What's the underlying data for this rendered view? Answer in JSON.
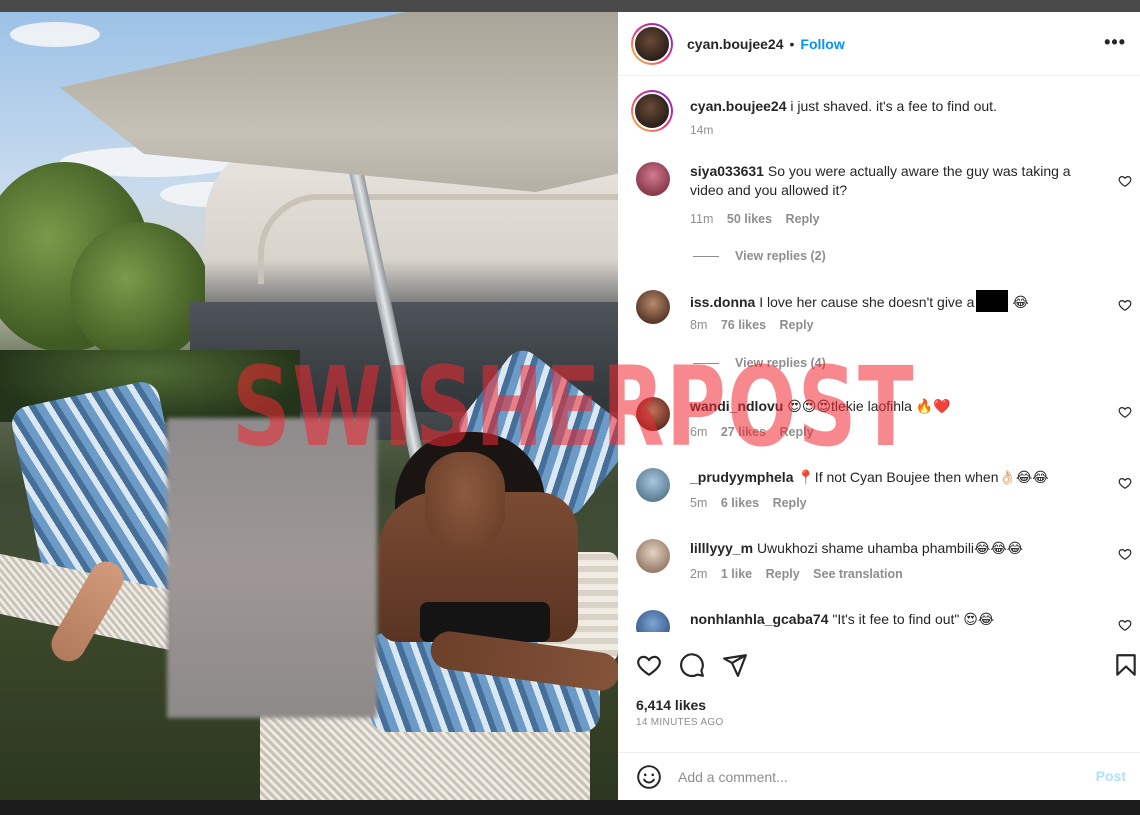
{
  "post": {
    "username": "cyan.boujee24",
    "follow_label": "Follow",
    "separator": "•",
    "more_label": "•••",
    "watermark": "SWISHERPOST"
  },
  "caption": {
    "username": "cyan.boujee24",
    "text": "i just shaved. it's a fee to find out.",
    "time": "14m"
  },
  "comments": [
    {
      "username": "siya033631",
      "text": "So you were actually aware the guy was taking a video and you allowed it?",
      "time": "11m",
      "likes": "50 likes",
      "reply": "Reply",
      "view_replies": "View replies (2)"
    },
    {
      "username": "iss.donna",
      "text_before": "I love her cause she doesn't give a",
      "text_after": "😂",
      "time": "8m",
      "likes": "76 likes",
      "reply": "Reply",
      "view_replies": "View replies (4)"
    },
    {
      "username": "wandi_ndlovu",
      "text": "😍😍😍tlekie laofihla 🔥❤️",
      "time": "6m",
      "likes": "27 likes",
      "reply": "Reply"
    },
    {
      "username": "_prudyymphela",
      "text": "📍If not Cyan Boujee then when👌🏻😂😂",
      "time": "5m",
      "likes": "6 likes",
      "reply": "Reply"
    },
    {
      "username": "lilllyyy_m",
      "text": "Uwukhozi shame uhamba phambili😂😂😂",
      "time": "2m",
      "likes": "1 like",
      "reply": "Reply",
      "translate": "See translation"
    },
    {
      "username": "nonhlanhla_gcaba74",
      "text": "\"It's it fee to find out\" 😍😂"
    }
  ],
  "stats": {
    "likes": "6,414 likes",
    "ago": "14 MINUTES AGO"
  },
  "add_comment": {
    "placeholder": "Add a comment...",
    "post_label": "Post"
  },
  "icons": [
    "heart-icon",
    "comment-icon",
    "share-icon",
    "bookmark-icon",
    "emoji-icon",
    "more-icon"
  ],
  "colors": {
    "accent": "#0095f6",
    "muted": "#8e8e8e",
    "text": "#262626",
    "watermark": "#f02832"
  }
}
